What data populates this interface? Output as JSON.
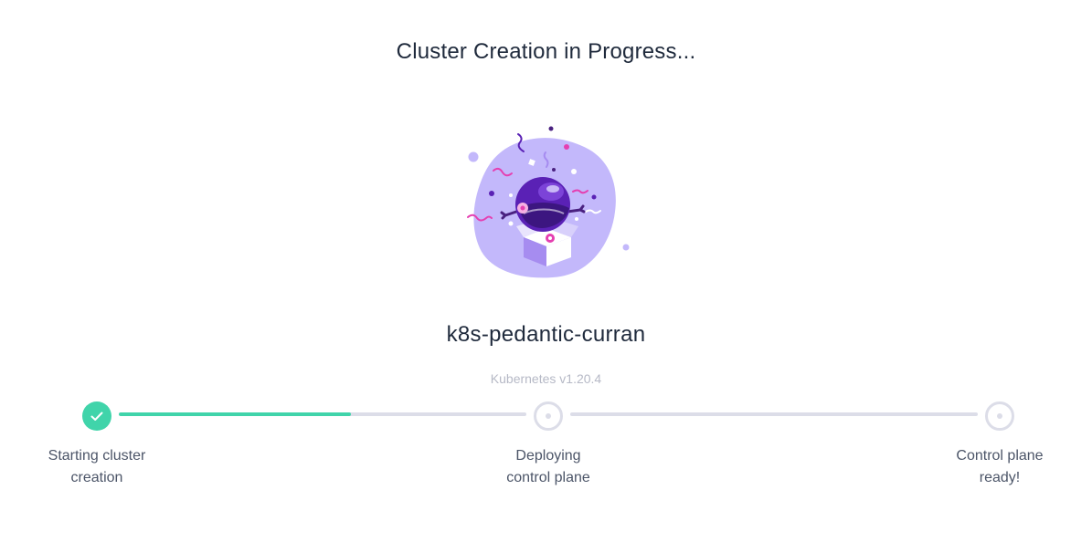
{
  "page_title": "Cluster Creation in Progress...",
  "illustration": {
    "name": "celebration-robot-illustration",
    "blob_color": "#c3b8fb",
    "robot_color": "#5a21b5"
  },
  "cluster": {
    "name": "k8s-pedantic-curran",
    "version": "Kubernetes v1.20.4"
  },
  "steps": [
    {
      "line1": "Starting cluster",
      "line2": "creation",
      "status": "complete"
    },
    {
      "line1": "Deploying",
      "line2": "control plane",
      "status": "pending"
    },
    {
      "line1": "Control plane",
      "line2": "ready!",
      "status": "pending"
    }
  ],
  "progress": {
    "segment_1_fill_fraction": 0.57,
    "segment_2_fill_fraction": 0
  },
  "colors": {
    "accent": "#40d4aa",
    "track": "#dcdde8",
    "text_primary": "#1f2a3c",
    "text_secondary": "#4c5568",
    "text_muted": "#b6b9c6"
  }
}
